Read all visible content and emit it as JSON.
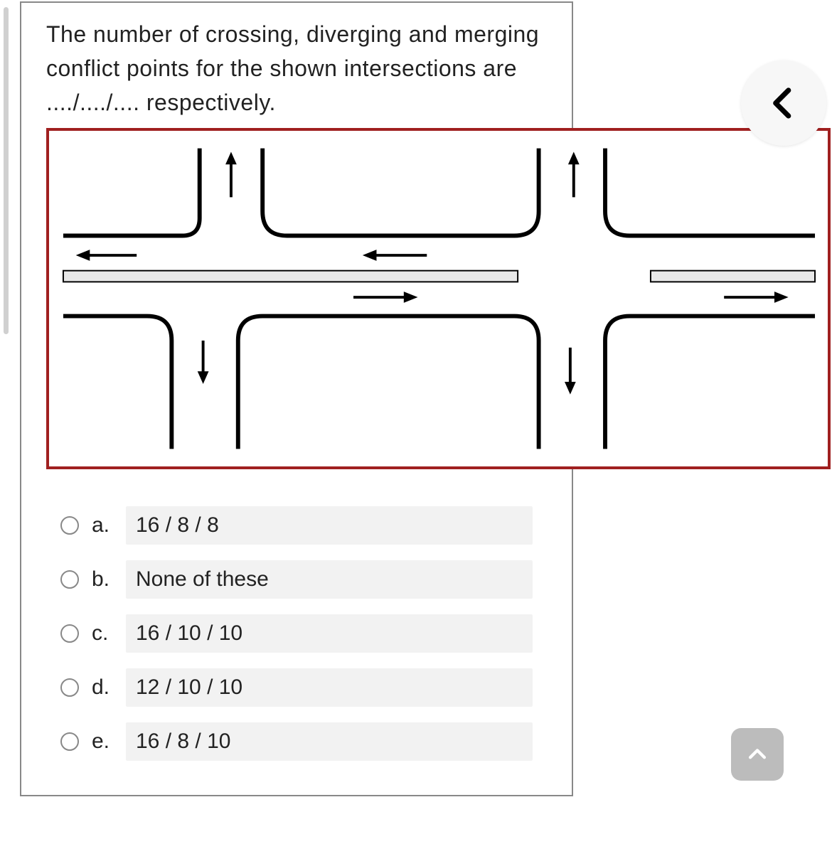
{
  "question": {
    "text": "The number of crossing, diverging and merging conflict points for the shown intersections are ..../..../.... respectively."
  },
  "options": [
    {
      "letter": "a.",
      "text": "16 / 8 / 8"
    },
    {
      "letter": "b.",
      "text": "None of these"
    },
    {
      "letter": "c.",
      "text": "16 / 10 / 10"
    },
    {
      "letter": "d.",
      "text": "12 / 10 / 10"
    },
    {
      "letter": "e.",
      "text": "16 / 8 / 10"
    }
  ],
  "icons": {
    "back": "chevron-left-icon",
    "up": "chevron-up-icon"
  }
}
